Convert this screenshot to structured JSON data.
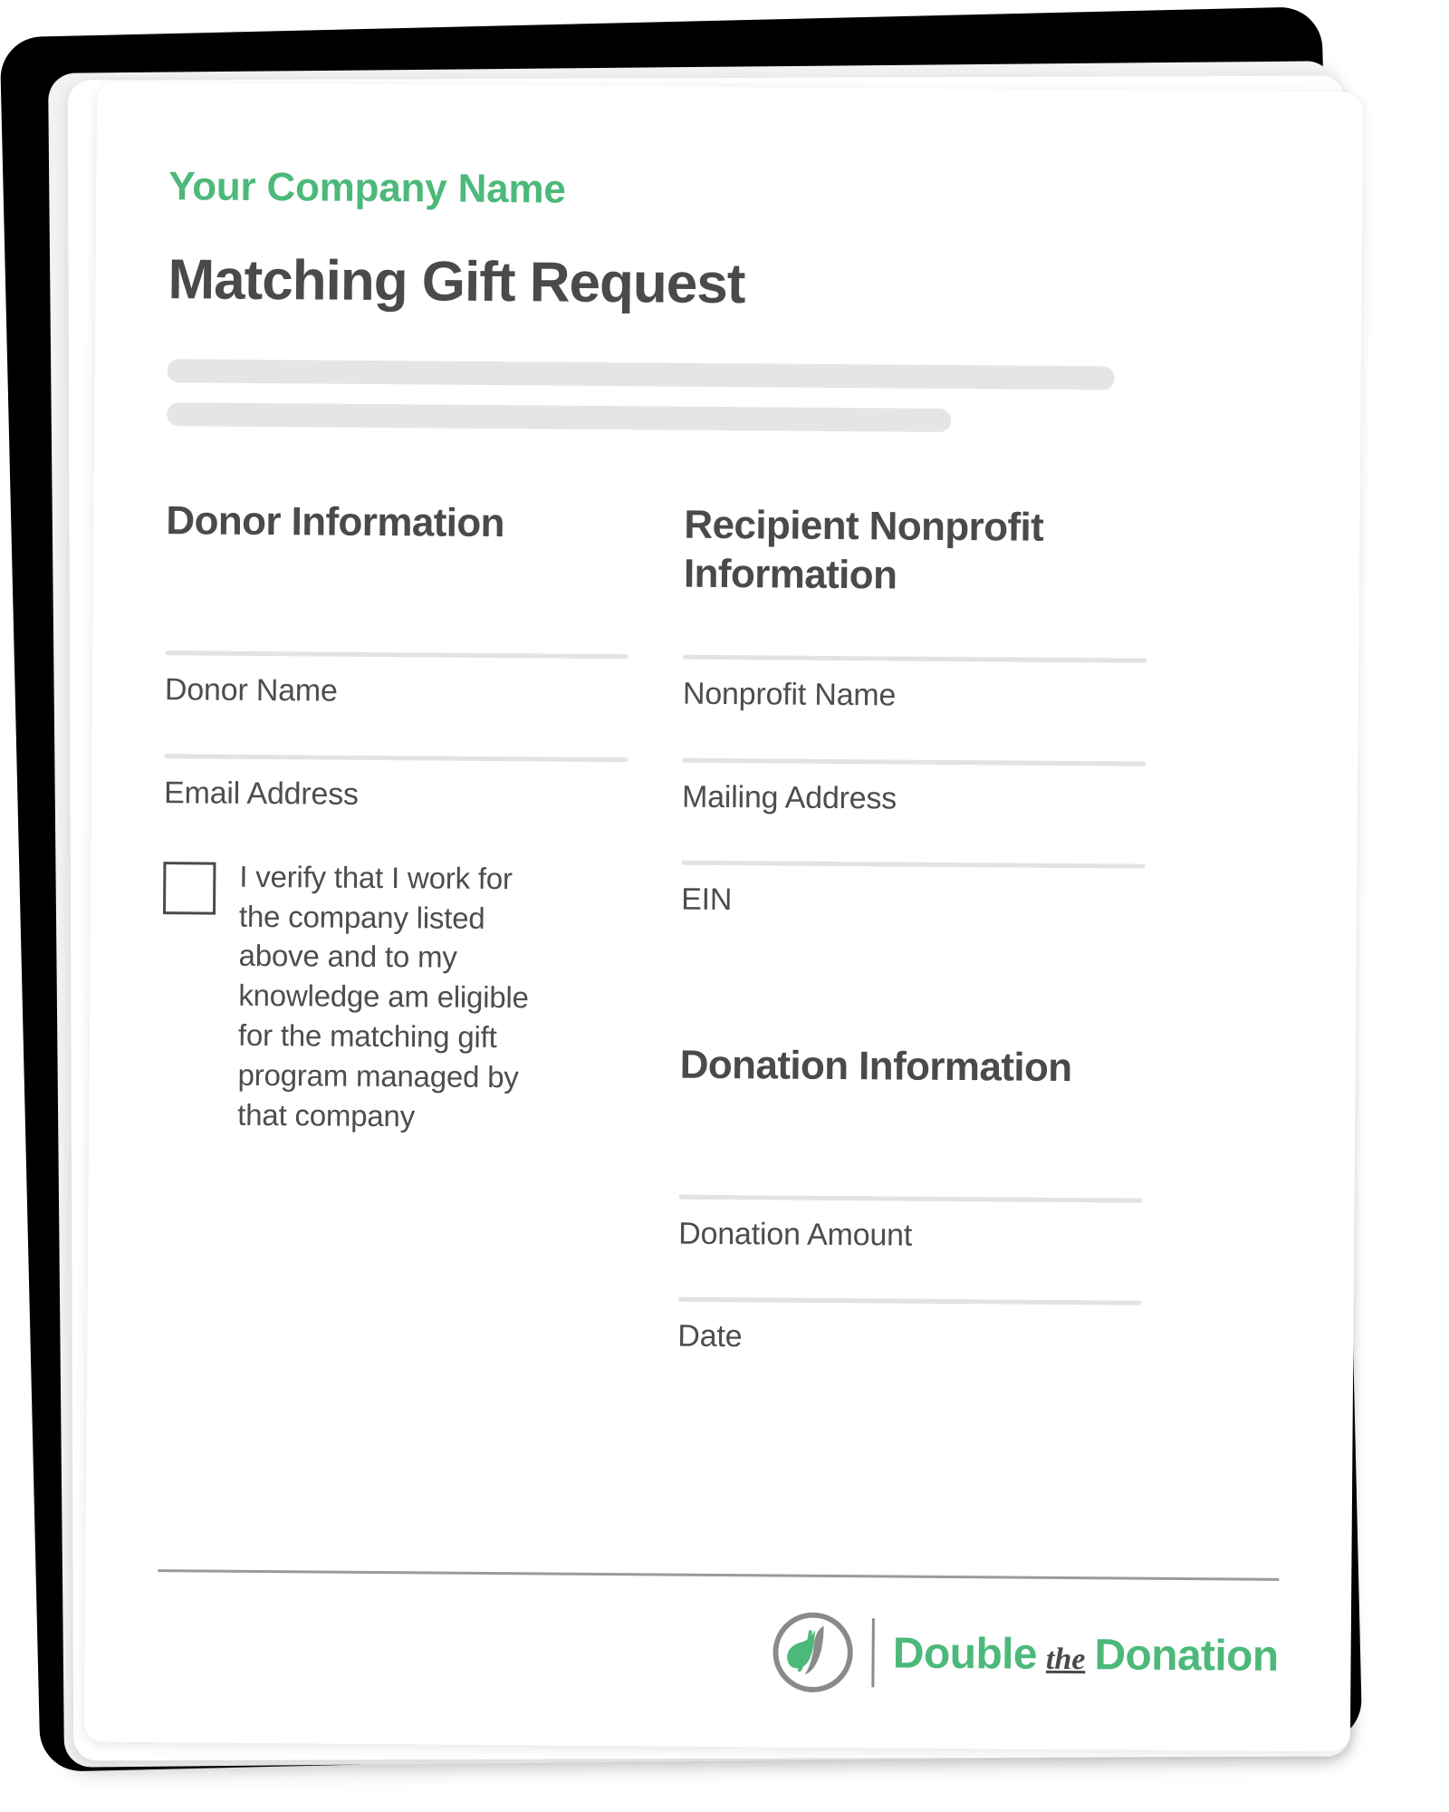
{
  "colors": {
    "brand_green": "#4cb97a",
    "text_dark": "#4a4a4a",
    "field_rule": "#e3e3e3",
    "placeholder_bar": "#e5e5e5",
    "sheet_black": "#000000"
  },
  "header": {
    "company_name": "Your Company Name",
    "document_title": "Matching Gift Request"
  },
  "donor_section": {
    "heading": "Donor Information",
    "fields": [
      {
        "label": "Donor Name"
      },
      {
        "label": "Email Address"
      }
    ],
    "verification": {
      "checked": false,
      "text": "I verify that I work for the company listed above and to my knowledge am eligible for the matching gift program managed by that company"
    }
  },
  "recipient_section": {
    "heading": "Recipient Nonprofit Information",
    "fields": [
      {
        "label": "Nonprofit Name"
      },
      {
        "label": "Mailing Address"
      },
      {
        "label": "EIN"
      }
    ]
  },
  "donation_section": {
    "heading": "Donation Information",
    "fields": [
      {
        "label": "Donation Amount"
      },
      {
        "label": "Date"
      }
    ]
  },
  "footer": {
    "logo": {
      "icon": "double-the-donation-logo-icon",
      "word1": "Double",
      "word2": "the",
      "word3": "Donation"
    }
  }
}
